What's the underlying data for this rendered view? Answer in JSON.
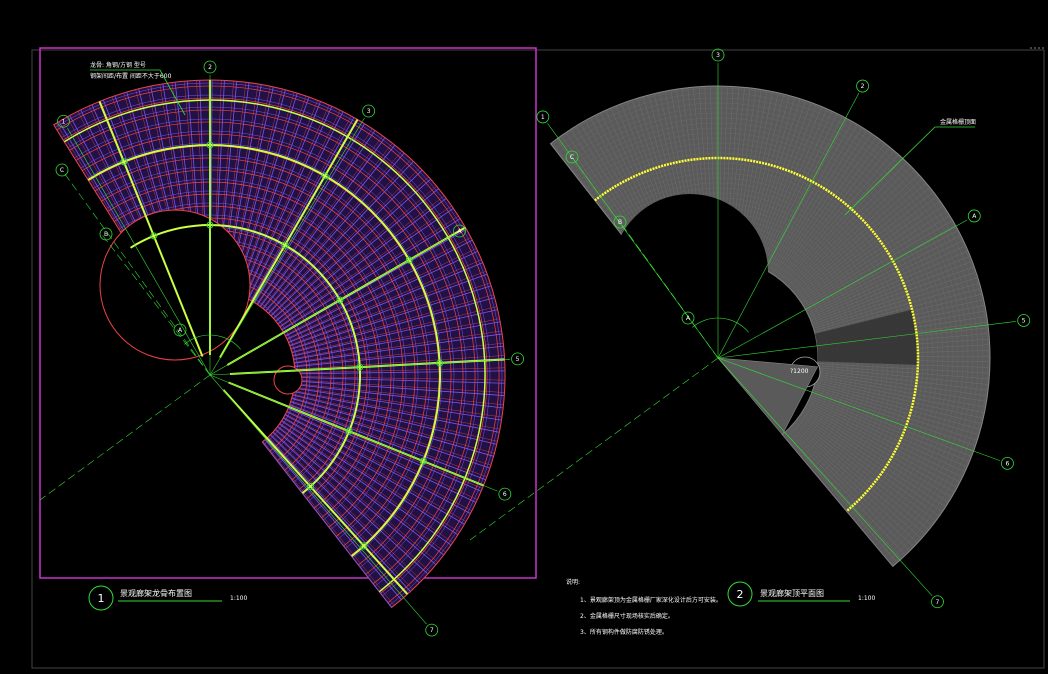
{
  "drawing1": {
    "number": "1",
    "title": "景观廊架龙骨布置图",
    "scale": "1:100",
    "note_line1": "龙骨: 角钢/方钢 型号",
    "note_line2": "钢架间距/布置 间距不大于600",
    "axes": [
      "1",
      "2",
      "3",
      "A",
      "5",
      "6",
      "7",
      "C",
      "B",
      "A"
    ]
  },
  "drawing2": {
    "number": "2",
    "title": "景观廊架顶平面图",
    "scale": "1:100",
    "leader_label": "金属格栅顶面",
    "hole_label": "?1200",
    "axes": [
      "1",
      "3",
      "2",
      "A",
      "5",
      "6",
      "7",
      "C",
      "B",
      "A"
    ]
  },
  "notes": {
    "heading": "说明:",
    "items": [
      "1、景观廊架顶为金属格栅厂家深化设计后方可安装。",
      "2、金属格栅尺寸现场核实后确定。",
      "3、所有钢构件做防腐防锈处理。"
    ]
  },
  "colors": {
    "background": "#000000",
    "frame": "#cc33cc",
    "grid_purple": "#7755ee",
    "grid_red": "#ee4444",
    "green": "#33dd33",
    "lime": "#ccff44",
    "yellow": "#ffff33",
    "gray_fill": "#5a5a5a",
    "white": "#ffffff"
  }
}
